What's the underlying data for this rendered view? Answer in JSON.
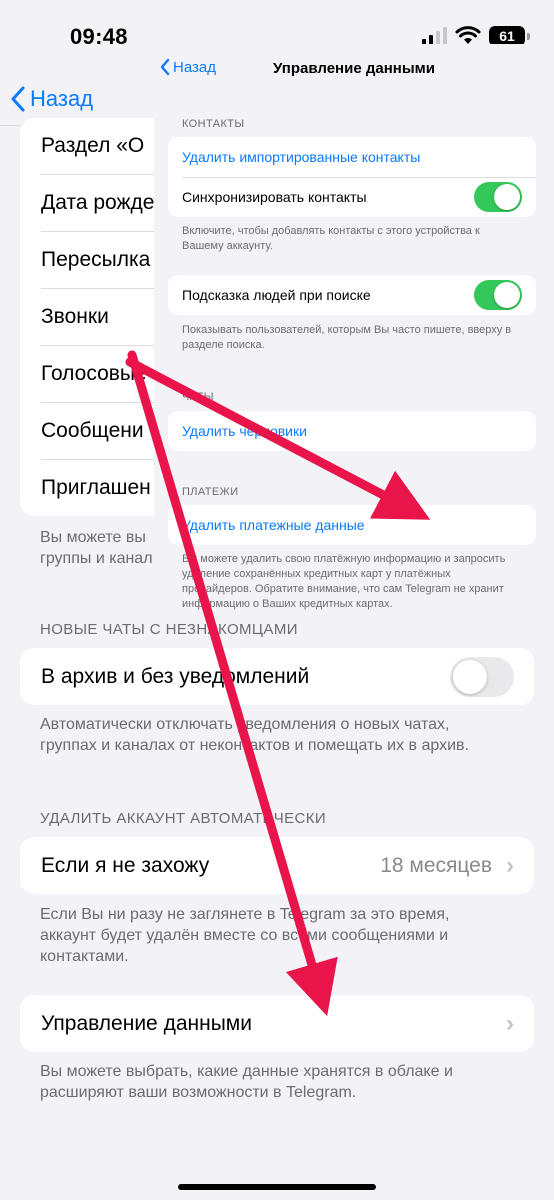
{
  "status": {
    "time": "09:48",
    "battery": "61"
  },
  "background": {
    "back_label": "Назад",
    "privacy_items": [
      "Раздел «О",
      "Дата рожде",
      "Пересылка",
      "Звонки",
      "Голосовые",
      "Сообщени",
      "Приглашен"
    ],
    "privacy_footer": "Вы можете вы\nгруппы и канал",
    "new_chats_header": "НОВЫЕ ЧАТЫ С НЕЗНАКОМЦАМИ",
    "archive_label": "В архив и без уведомлений",
    "archive_footer": "Автоматически отключать уведомления о новых чатах, группах и каналах от неконтактов и помещать их в архив.",
    "delete_header": "УДАЛИТЬ АККАУНТ АВТОМАТИЧЕСКИ",
    "inactive_label": "Если я не захожу",
    "inactive_value": "18 месяцев",
    "inactive_footer": "Если Вы ни разу не заглянете в Telegram за это время, аккаунт будет удалён вместе со всеми сообщениями и контактами.",
    "data_mgmt_label": "Управление данными",
    "data_mgmt_footer": "Вы можете выбрать, какие данные хранятся в облаке и расширяют ваши возможности в Telegram."
  },
  "overlay": {
    "back_label": "Назад",
    "title": "Управление данными",
    "contacts_header": "КОНТАКТЫ",
    "delete_imported": "Удалить импортированные контакты",
    "sync_contacts": "Синхронизировать контакты",
    "sync_footer": "Включите, чтобы добавлять контакты с этого устройства к Вашему аккаунту.",
    "suggest_people": "Подсказка людей при поиске",
    "suggest_footer": "Показывать пользователей, которым Вы часто пишете, вверху в разделе поиска.",
    "chats_header": "ЧАТЫ",
    "delete_drafts": "Удалить черновики",
    "payments_header": "ПЛАТЕЖИ",
    "delete_payments": "Удалить платежные данные",
    "payments_footer": "Вы можете удалить свою платёжную информацию и запросить удаление сохранённых кредитных карт у платёжных провайдеров. Обратите внимание, что сам Telegram не хранит информацию о Ваших кредитных картах."
  },
  "colors": {
    "accent": "#0a7aff",
    "toggle_on": "#34c759",
    "arrow": "#e8144a"
  }
}
